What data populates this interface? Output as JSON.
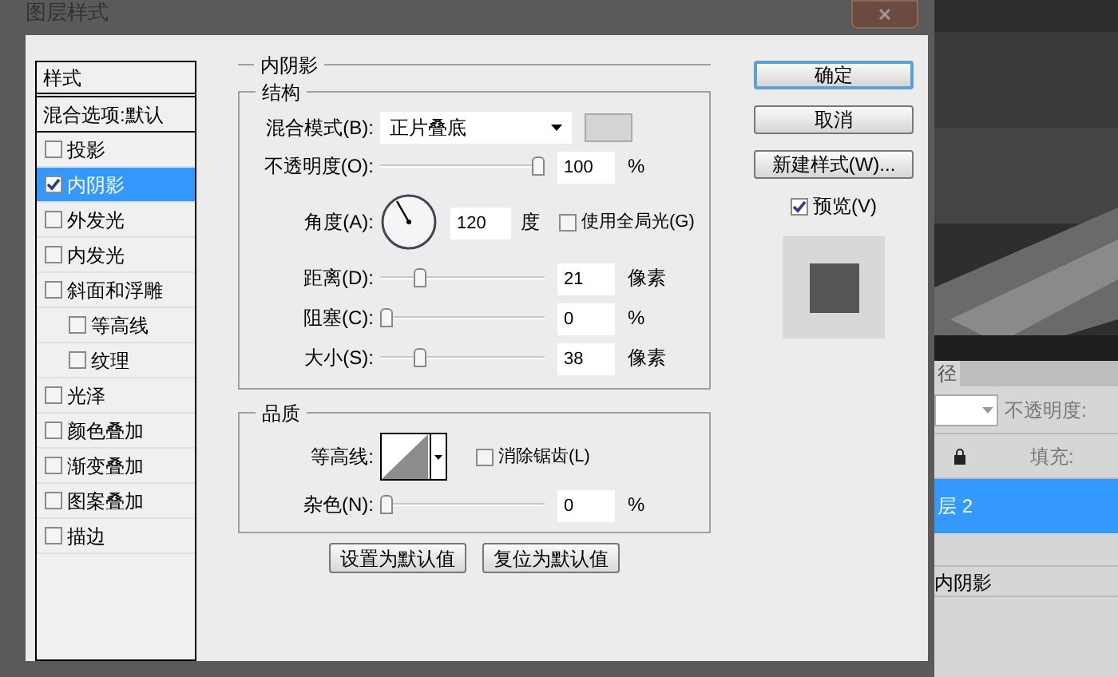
{
  "dialog": {
    "title": "图层样式"
  },
  "styles_list": {
    "header": "样式",
    "blend_options": "混合选项:默认",
    "items": [
      {
        "label": "投影",
        "checked": false,
        "selected": false
      },
      {
        "label": "内阴影",
        "checked": true,
        "selected": true
      },
      {
        "label": "外发光",
        "checked": false,
        "selected": false
      },
      {
        "label": "内发光",
        "checked": false,
        "selected": false
      },
      {
        "label": "斜面和浮雕",
        "checked": false,
        "selected": false,
        "children": [
          {
            "label": "等高线",
            "checked": false,
            "selected": false
          },
          {
            "label": "纹理",
            "checked": false,
            "selected": false
          }
        ]
      },
      {
        "label": "光泽",
        "checked": false,
        "selected": false
      },
      {
        "label": "颜色叠加",
        "checked": false,
        "selected": false
      },
      {
        "label": "渐变叠加",
        "checked": false,
        "selected": false
      },
      {
        "label": "图案叠加",
        "checked": false,
        "selected": false
      },
      {
        "label": "描边",
        "checked": false,
        "selected": false
      }
    ]
  },
  "inner_shadow": {
    "title": "内阴影",
    "structure": {
      "title": "结构",
      "blend_mode": {
        "label": "混合模式(B):",
        "value": "正片叠底"
      },
      "angle": {
        "label": "角度(A):",
        "value": "120",
        "unit": "度",
        "global_light": {
          "label": "使用全局光(G)",
          "checked": false
        }
      },
      "sliders": [
        {
          "kind": "slider",
          "label": "不透明度(O):",
          "level": 1.0,
          "value": "100",
          "unit": "%"
        },
        {
          "kind": "angle"
        },
        {
          "kind": "slider",
          "label": "距离(D):",
          "level": 0.22,
          "value": "21",
          "unit": "像素"
        },
        {
          "kind": "slider",
          "label": "阻塞(C):",
          "level": 0,
          "value": "0",
          "unit": "%"
        },
        {
          "kind": "slider",
          "label": "大小(S):",
          "level": 0.22,
          "value": "38",
          "unit": "像素"
        }
      ]
    },
    "quality": {
      "title": "品质",
      "contour": {
        "label": "等高线:"
      },
      "anti_alias": {
        "label": "消除锯齿(L)",
        "checked": false
      },
      "noise": {
        "label": "杂色(N):",
        "level": 0,
        "value": "0",
        "unit": "%"
      }
    },
    "buttons": [
      "设置为默认值",
      "复位为默认值"
    ]
  },
  "actions": [
    {
      "label": "确定",
      "kind": "default"
    },
    {
      "label": "取消",
      "kind": "normal"
    },
    {
      "label": "新建样式(W)...",
      "kind": "normal"
    }
  ],
  "preview": {
    "label": "预览(V)",
    "checked": true
  },
  "layers_panel": {
    "tab": "径",
    "opacity_label": "不透明度:",
    "fill_label": "填充:",
    "layers": [
      {
        "name": "层 2",
        "kind": "layer",
        "selected": true
      },
      {
        "name": "内阴影",
        "kind": "effect",
        "selected": false
      }
    ]
  }
}
